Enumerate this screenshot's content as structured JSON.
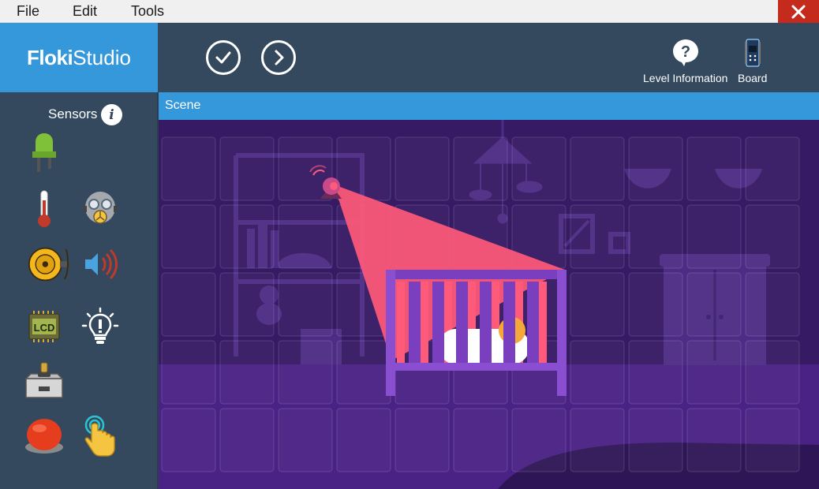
{
  "menu": {
    "file": "File",
    "edit": "Edit",
    "tools": "Tools"
  },
  "app": {
    "logo_bold": "Floki",
    "logo_light": "Studio"
  },
  "toolbar": {
    "level_information_label": "Level Information",
    "board_label": "Board"
  },
  "sidebar": {
    "title": "Sensors",
    "items": [
      {
        "icon": "led-icon"
      },
      {
        "icon": "thermometer-icon"
      },
      {
        "icon": "gas-mask-icon"
      },
      {
        "icon": "alarm-bell-icon"
      },
      {
        "icon": "speaker-icon"
      },
      {
        "icon": "lcd-icon",
        "label": "LCD"
      },
      {
        "icon": "light-bulb-icon"
      },
      {
        "icon": "joystick-icon"
      },
      {
        "icon": "push-button-icon"
      },
      {
        "icon": "touch-sensor-icon"
      }
    ]
  },
  "scene": {
    "title": "Scene"
  },
  "colors": {
    "accent_blue": "#3498db",
    "header_dark": "#34495e",
    "scene_purple": "#361a63",
    "camera_beam": "#ff5a7a",
    "close_red": "#c42b1c"
  }
}
